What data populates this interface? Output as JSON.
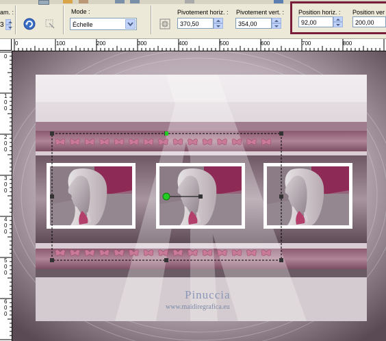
{
  "toolbar": {
    "param_label_partial": "am. :",
    "param_value_partial": "3",
    "mode_label": "Mode :",
    "mode_value": "Échelle",
    "rot_h_label": "Pivotement horiz. :",
    "rot_h_value": "370,50",
    "rot_v_label": "Pivotement vert. :",
    "rot_v_value": "354,00",
    "pos_h_label": "Position horiz. :",
    "pos_h_value": "92,00",
    "pos_v_label": "Position ver",
    "pos_v_value": "200,00",
    "highlight_color": "#7a1d3b"
  },
  "rulers": {
    "horizontal_labels": [
      "0",
      "100",
      "200",
      "300",
      "400",
      "500",
      "600",
      "700",
      "800"
    ],
    "vertical_labels": [
      "0",
      "100",
      "200",
      "300",
      "400",
      "500",
      "600"
    ]
  },
  "image": {
    "signature": "Pinuccia",
    "url_text": "www.maidiregrafica.eu"
  },
  "colors": {
    "accent_pink": "#c87a96",
    "handle_green": "#22cc22",
    "frame_white": "#ffffff",
    "mauve": "#8e5870"
  }
}
